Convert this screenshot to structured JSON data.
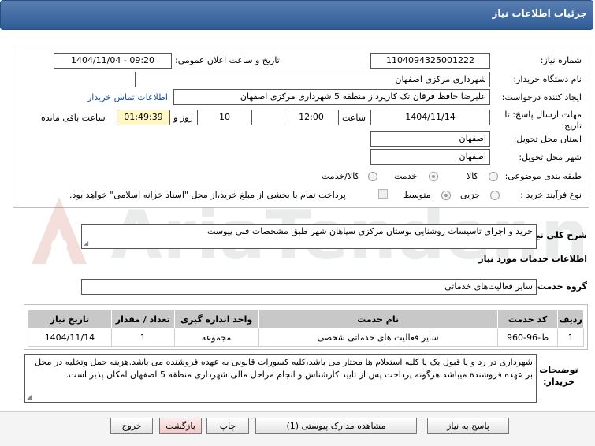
{
  "header": {
    "title": "جزئیات اطلاعات نیاز"
  },
  "form": {
    "need_number_label": "شماره نیاز:",
    "need_number": "1104094325001222",
    "announce_label": "تاریخ و ساعت اعلان عمومی:",
    "announce_value": "1404/11/04 - 09:20",
    "buyer_org_label": "نام دستگاه خریدار:",
    "buyer_org": "شهرداری مرکزی اصفهان",
    "creator_label": "ایجاد کننده درخواست:",
    "creator": "علیرضا حافظ فرقان تک کارپرداز منطقه 5 شهرداری مرکزی اصفهان",
    "contact_link": "اطلاعات تماس خریدار",
    "deadline_label": "مهلت ارسال پاسخ: تا تاریخ:",
    "deadline_date": "1404/11/14",
    "time_label": "ساعت",
    "deadline_time": "12:00",
    "days_value": "10",
    "days_label": "روز و",
    "remaining_time": "01:49:39",
    "remaining_label": "ساعت باقی مانده",
    "province_label": "استان محل تحویل:",
    "province": "اصفهان",
    "city_label": "شهر محل تحویل:",
    "city": "اصفهان",
    "category_label": "طبقه بندی موضوعی:",
    "category_options": [
      "کالا",
      "خدمت",
      "کالا/خدمت"
    ],
    "purchase_label": "نوع فرآیند خرید :",
    "purchase_options": [
      "جزیی",
      "متوسط"
    ],
    "payment_text": "پرداخت تمام یا بخشی از مبلغ خرید،از محل \"اسناد خزانه اسلامی\" خواهد بود."
  },
  "description": {
    "label": "شرح کلی نیاز:",
    "value": "خرید و اجرای تاسیسات روشنایی بوستان مرکزی سپاهان شهر طبق مشخصات فنی پیوست"
  },
  "services": {
    "section_title": "اطلاعات خدمات مورد نیاز",
    "group_label": "گروه خدمت:",
    "group_value": "سایر فعالیت‌های خدماتی",
    "columns": [
      "ردیف",
      "کد خدمت",
      "نام خدمت",
      "واحد اندازه گیری",
      "تعداد / مقدار",
      "تاریخ نیاز"
    ],
    "rows": [
      [
        "1",
        "ط-96-960",
        "سایر فعالیت های خدماتی شخصی",
        "مجموعه",
        "1",
        "1404/11/14"
      ]
    ]
  },
  "buyer_notes": {
    "label": "توضیحات خریدار:",
    "text": "شهرداری در رد و یا قبول یک یا کلیه استعلام ها مختار می باشد،کلیه کسورات قانونی به عهده فروشنده می باشد.هزینه حمل وتخلیه در محل بر عهده فروشندة میباشد.هرگونه پرداخت پس از تایید کارشناس و انجام مراحل مالی شهرداری منطقه 5 اصفهان امکان پذیر است."
  },
  "buttons": {
    "reply": "پاسخ به نیاز",
    "docs": "مشاهده مدارک پیوستی (1)",
    "print": "چاپ",
    "back": "بازگشت",
    "exit": "خروج"
  },
  "watermark": "AriaTender.net",
  "colors": {
    "header": "#2f5c97",
    "link": "#1a4fb3",
    "watermark": "#c0392b"
  }
}
